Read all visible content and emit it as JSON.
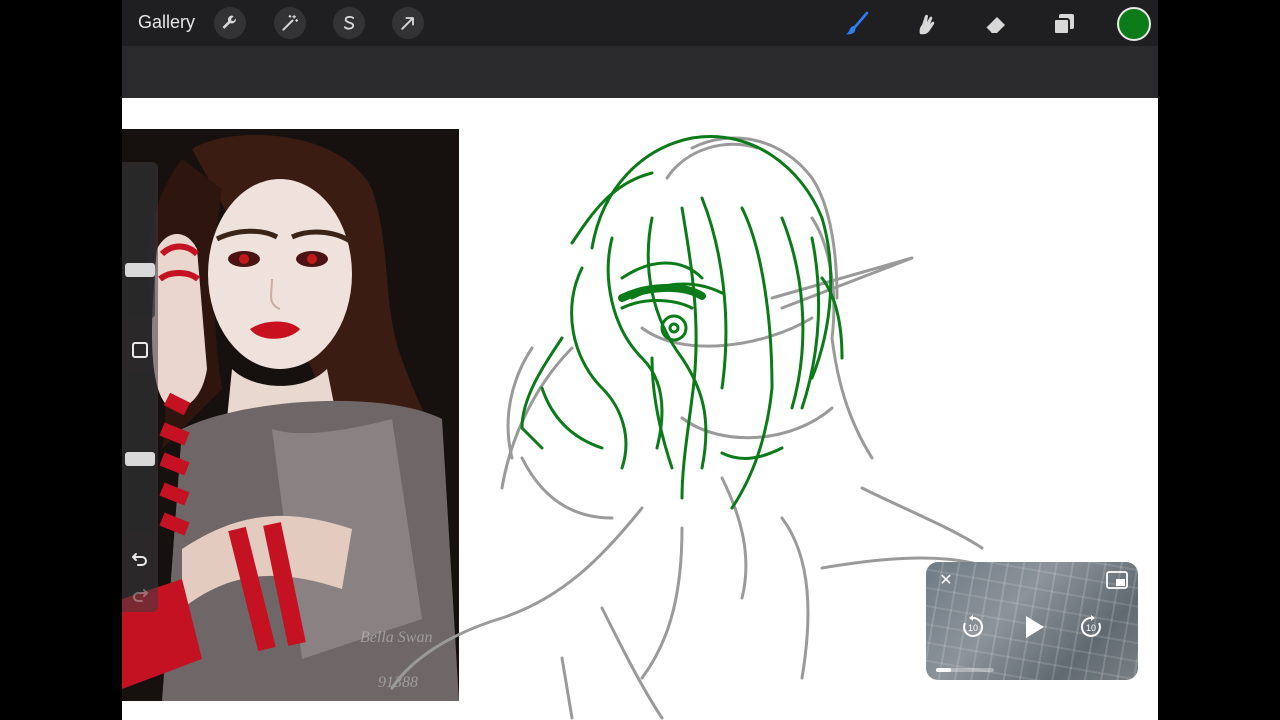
{
  "toolbar": {
    "gallery_label": "Gallery",
    "left_tools": [
      "wrench-icon",
      "magic-wand-icon",
      "selection-s-icon",
      "arrow-cursor-icon"
    ],
    "right_tools": [
      "brush-icon",
      "smudge-icon",
      "eraser-icon",
      "layers-icon"
    ],
    "active_tool": "brush-icon",
    "current_color": "#0b7a18"
  },
  "reference": {
    "watermark_name": "Bella Swan",
    "watermark_number": "91388"
  },
  "sidebar": {
    "brush_size_level": 0.3,
    "opacity_level": 0.45
  },
  "pip_player": {
    "skip_back_seconds": "10",
    "skip_forward_seconds": "10",
    "progress": 0.25
  },
  "colors": {
    "sketch_green": "#0b7a18",
    "sketch_gray": "#9a9a9a",
    "toolbar_bg": "#1f1f21",
    "canvas_bg": "#ffffff",
    "brush_active": "#2f7df6"
  }
}
